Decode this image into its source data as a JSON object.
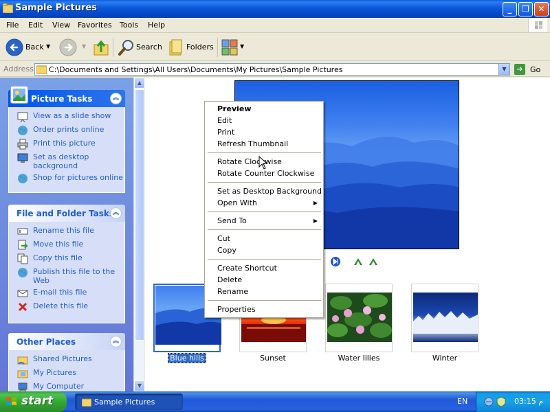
{
  "window": {
    "title": "Sample Pictures",
    "buttons": {
      "minimize": "_",
      "maximize": "❐",
      "close": "✕"
    }
  },
  "menubar": [
    "File",
    "Edit",
    "View",
    "Favorites",
    "Tools",
    "Help"
  ],
  "toolbar": {
    "back": "Back",
    "search": "Search",
    "folders": "Folders"
  },
  "address": {
    "label": "Address",
    "path": "C:\\Documents and Settings\\All Users\\Documents\\My Pictures\\Sample Pictures",
    "go": "Go"
  },
  "sidebar": {
    "picture_tasks": {
      "title": "Picture Tasks",
      "items": [
        "View as a slide show",
        "Order prints online",
        "Print this picture",
        "Set as desktop background",
        "Shop for pictures online"
      ]
    },
    "file_folder_tasks": {
      "title": "File and Folder Tasks",
      "items": [
        "Rename this file",
        "Move this file",
        "Copy this file",
        "Publish this file to the Web",
        "E-mail this file",
        "Delete this file"
      ]
    },
    "other_places": {
      "title": "Other Places",
      "items": [
        "Shared Pictures",
        "My Pictures",
        "My Computer"
      ]
    }
  },
  "thumbnails": [
    {
      "label": "Blue hills",
      "selected": true
    },
    {
      "label": "Sunset",
      "selected": false
    },
    {
      "label": "Water lilies",
      "selected": false
    },
    {
      "label": "Winter",
      "selected": false
    }
  ],
  "context_menu": {
    "group1": [
      "Preview",
      "Edit",
      "Print",
      "Refresh Thumbnail"
    ],
    "group2": [
      "Rotate Clockwise",
      "Rotate Counter Clockwise"
    ],
    "group3": [
      "Set as Desktop Background",
      "Open With"
    ],
    "group4": [
      "Send To"
    ],
    "group5": [
      "Cut",
      "Copy"
    ],
    "group6": [
      "Create Shortcut",
      "Delete",
      "Rename"
    ],
    "group7": [
      "Properties"
    ]
  },
  "taskbar": {
    "start": "start",
    "task": "Sample Pictures",
    "language": "EN",
    "clock": "03:15 م"
  },
  "colors": {
    "titlebar": "#0a58d8",
    "taskbar": "#2157d7",
    "start": "#32a532",
    "selection": "#316ac5",
    "sidebar_link": "#215dc6"
  }
}
